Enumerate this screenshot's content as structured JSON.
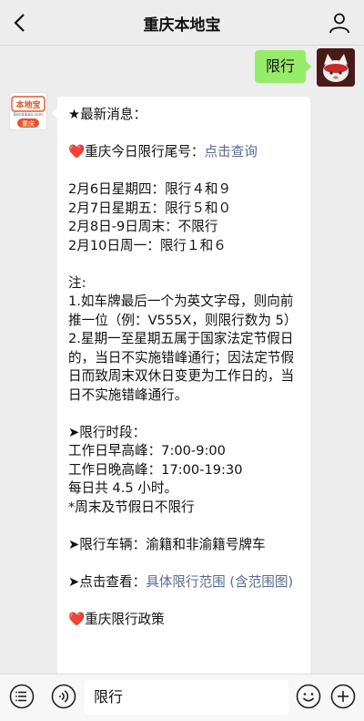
{
  "header": {
    "title": "重庆本地宝"
  },
  "sent_message": {
    "text": "限行"
  },
  "bot_avatar": {
    "brand": "本地宝",
    "brand_sub": "Bendibao.com",
    "city": "重庆"
  },
  "reply": {
    "headline": "★最新消息：",
    "query_prefix": "❤️重庆今日限行尾号：",
    "query_link": "点击查询",
    "days": [
      "2月6日星期四：限行４和９",
      "2月7日星期五：限行５和０",
      "2月8日-9日周末：不限行",
      "2月10日周一：限行１和６"
    ],
    "note_title": "注:",
    "notes": [
      "1.如车牌最后一个为英文字母，则向前推一位（例：V555X，则限行数为 5）",
      "2.星期一至星期五属于国家法定节假日的，当日不实施错峰通行；因法定节假日而致周末双休日变更为工作日的，当日不实施错峰通行。"
    ],
    "time_title": "➤限行时段：",
    "times": [
      "工作日早高峰：7:00-9:00",
      "工作日晚高峰：17:00-19:30",
      "每日共 4.5 小时。",
      "*周末及节假日不限行"
    ],
    "vehicles": "➤限行车辆：渝籍和非渝籍号牌车",
    "view_prefix": "➤点击查看：",
    "view_link": "具体限行范围 (含范围图)",
    "policy": "❤️重庆限行政策"
  },
  "input_bar": {
    "value": "限行"
  },
  "colors": {
    "link": "#576b95",
    "sent_bubble": "#95ec69",
    "background": "#ededed"
  }
}
